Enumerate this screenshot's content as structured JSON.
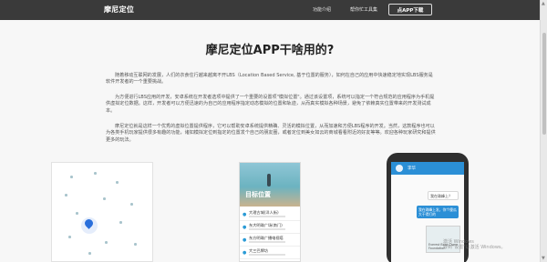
{
  "nav": {
    "brand": "摩尼定位",
    "features": "功能介绍",
    "tools": "帮你忙工具集",
    "download": "点APP下载"
  },
  "main": {
    "title": "摩尼定位APP干啥用的?",
    "paragraphs": [
      "随着移动互联网的发展，人们的衣食住行越来越离不开LBS（Location Based Service, 基于位置的服务），如何在自己的应用中快速稳定地实现LBS服务是软件开发者的一个重要挑战。",
      "为方便进行LBS应用的开发，安卓系统在开发者选项中提供了一个重要的设置项\"模拟位置\"。通过该设置项，系统可以指定一个符合规范的应用程序为手机提供虚拟定位数据。这样，开发者可以方便迅速的为自己的应用程序指定动态模拟的位置和轨迹，从而真实模拟各种场景，避免了依赖真实位置带来的开发测试成本。",
      "摩尼定位就是这样一个优秀的虚拟位置提供程序，它可以帮助安卓系统提供精确、灵活的模拟位置，从而加速和方便LBS程序的开发。当然，这款程序也可以为各类手机玩家提供很多有趣的功能，诸如模拟定位到指定的位置发个自己的朋友圈，或者定位到美女如云的商城看看附近的好友等等。欢迎各种玩家研究和提供更多的玩法。"
    ]
  },
  "showcase": {
    "list_hero": "目标位置",
    "list_rows": [
      "大理古城(洋人街)",
      "东大明珠广场(南门)",
      "东方明珠广播电视塔",
      "大三巴牌坊"
    ],
    "phone_title": "李华",
    "chat_me": "我在珠峰上？",
    "chat_other": "我在珠峰上发，你个傻瓜大干得打的",
    "map_card": "Everest Base Camp Foundation",
    "watermark": [
      "激活 Windows",
      "转到\"设置\"以激活 Windows。"
    ]
  },
  "colors": {
    "nav_bg": "#3a3a3a",
    "accent_blue": "#2b8fd6",
    "page_bg": "#f7f7f7"
  }
}
